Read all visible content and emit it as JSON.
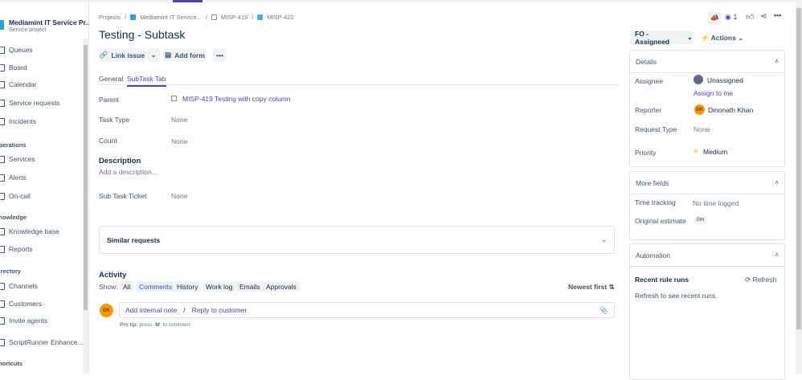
{
  "sidebar": {
    "project_title": "Mediamint IT Service Pr...",
    "project_sub": "Service project",
    "items": [
      {
        "label": "Queues"
      },
      {
        "label": "Board"
      },
      {
        "label": "Calendar"
      },
      {
        "label": "Service requests"
      },
      {
        "label": "Incidents"
      },
      {
        "label": "Services"
      },
      {
        "label": "Alerts"
      },
      {
        "label": "On-call"
      },
      {
        "label": "Knowledge base"
      },
      {
        "label": "Reports"
      },
      {
        "label": "Channels"
      },
      {
        "label": "Customers"
      },
      {
        "label": "Invite agents"
      },
      {
        "label": "ScriptRunner Enhance..."
      }
    ],
    "headers": [
      "Operations",
      "Knowledge",
      "Directory",
      "Shortcuts"
    ]
  },
  "breadcrumb": [
    "Projects",
    "Mediamint IT Service...",
    "MISP-419",
    "MISP-422"
  ],
  "title": "Testing - Subtask",
  "toolbar": {
    "link_issue": "Link issue",
    "add_form": "Add form",
    "more": "•••"
  },
  "tabs": [
    "General",
    "SubTask Tab"
  ],
  "fields": {
    "parent_label": "Parent",
    "parent_value": "MISP-419 Testing with copy column",
    "task_type_label": "Task Type",
    "task_type_value": "None",
    "count_label": "Count",
    "count_value": "None",
    "description_title": "Description",
    "description_placeholder": "Add a description...",
    "subtask_label": "Sub Task Ticket",
    "subtask_value": "None"
  },
  "similar": "Similar requests",
  "activity": {
    "title": "Activity",
    "show": "Show:",
    "filters": [
      "All",
      "Comments",
      "History",
      "Work log",
      "Emails",
      "Approvals"
    ],
    "sort": "Newest first",
    "avatar": "DK",
    "add_note": "Add internal note",
    "sep": "/",
    "reply": "Reply to customer",
    "protip_b": "Pro tip:",
    "protip_a": "press",
    "protip_key": "M",
    "protip_c": "to comment"
  },
  "header_actions": {
    "watch_count": "1",
    "status": "FO - Assigneed",
    "actions": "Actions"
  },
  "details": {
    "title": "Details",
    "assignee_label": "Assignee",
    "assignee": "Unassigned",
    "assign_me": "Assign to me",
    "reporter_label": "Reporter",
    "reporter_avatar": "DK",
    "reporter": "Dinonath Khan",
    "request_type_label": "Request Type",
    "request_type": "None",
    "priority_label": "Priority",
    "priority": "Medium"
  },
  "more_fields": {
    "title": "More fields",
    "time_label": "Time tracking",
    "time_value": "No time logged",
    "estimate_label": "Original estimate",
    "estimate_value": "0m"
  },
  "automation": {
    "title": "Automation",
    "recent": "Recent rule runs",
    "refresh": "Refresh",
    "hint": "Refresh to see recent runs."
  },
  "colors": {
    "accent": "#5243aa",
    "avatar": "#f79a00",
    "priority": "#ffab00"
  }
}
